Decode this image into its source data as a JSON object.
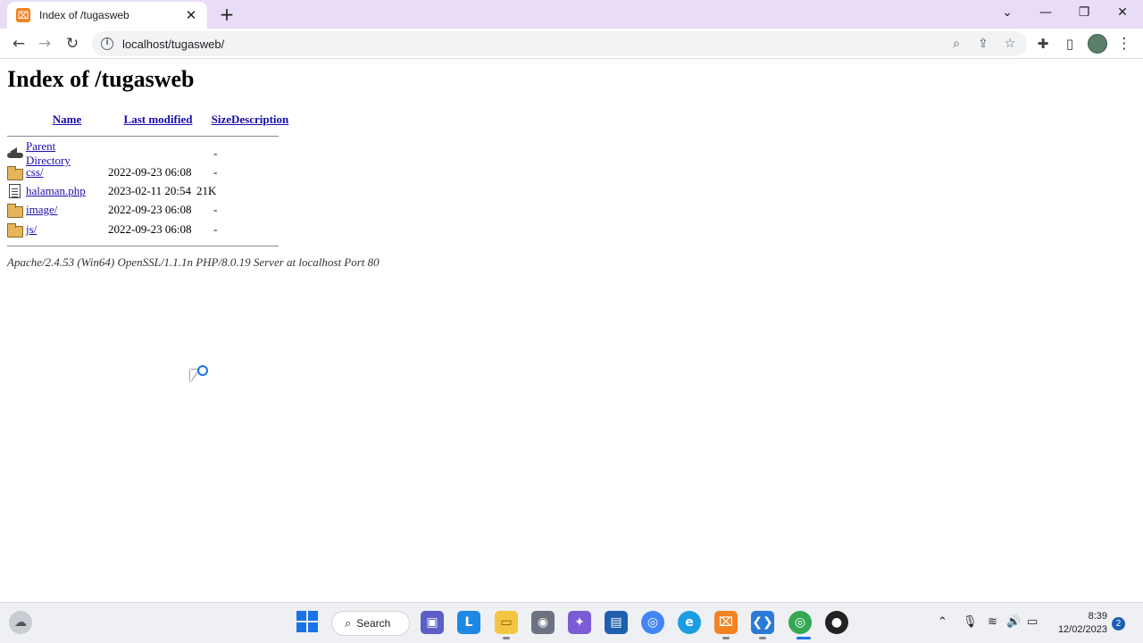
{
  "browser": {
    "tab_title": "Index of /tugasweb",
    "url": "localhost/tugasweb/"
  },
  "page": {
    "heading": "Index of /tugasweb",
    "columns": {
      "name": "Name",
      "last_modified": "Last modified",
      "size": "Size",
      "description": "Description"
    },
    "rows": [
      {
        "icon": "back-icon",
        "name": "Parent Directory",
        "modified": "",
        "size": "-"
      },
      {
        "icon": "folder-icon",
        "name": "css/",
        "modified": "2022-09-23 06:08",
        "size": "-"
      },
      {
        "icon": "file-icon",
        "name": "halaman.php",
        "modified": "2023-02-11 20:54",
        "size": "21K"
      },
      {
        "icon": "folder-icon",
        "name": "image/",
        "modified": "2022-09-23 06:08",
        "size": "-"
      },
      {
        "icon": "folder-icon",
        "name": "js/",
        "modified": "2022-09-23 06:08",
        "size": "-"
      }
    ],
    "address": "Apache/2.4.53 (Win64) OpenSSL/1.1.1n PHP/8.0.19 Server at localhost Port 80"
  },
  "taskbar": {
    "search_label": "Search",
    "time": "8:39",
    "date": "12/02/2023",
    "notification_count": "2"
  }
}
